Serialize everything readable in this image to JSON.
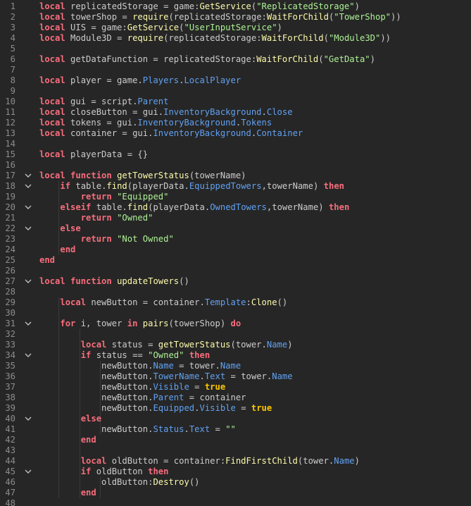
{
  "editor": {
    "language": "Lua",
    "first_line_number": 1,
    "fold_icon": "chevron-down-icon",
    "colors": {
      "background": "#262626",
      "line_number": "#8c8c8c",
      "text": "#cccccc",
      "keyword": "#f86d7c",
      "bool": "#ffc600",
      "method": "#fdfbac",
      "string": "#adf195",
      "property": "#61a1f1",
      "fold_icon": "#bdbdbd"
    },
    "lines": [
      {
        "tokens": [
          [
            "keyword",
            "local"
          ],
          [
            "text",
            " replicatedStorage = game:"
          ],
          [
            "method",
            "GetService"
          ],
          [
            "text",
            "("
          ],
          [
            "string",
            "\"ReplicatedStorage\""
          ],
          [
            "text",
            ")"
          ]
        ]
      },
      {
        "tokens": [
          [
            "keyword",
            "local"
          ],
          [
            "text",
            " towerShop = "
          ],
          [
            "method",
            "require"
          ],
          [
            "text",
            "(replicatedStorage:"
          ],
          [
            "method",
            "WaitForChild"
          ],
          [
            "text",
            "("
          ],
          [
            "string",
            "\"TowerShop\""
          ],
          [
            "text",
            "))"
          ]
        ]
      },
      {
        "tokens": [
          [
            "keyword",
            "local"
          ],
          [
            "text",
            " UIS = game:"
          ],
          [
            "method",
            "GetService"
          ],
          [
            "text",
            "("
          ],
          [
            "string",
            "\"UserInputService\""
          ],
          [
            "text",
            ")"
          ]
        ]
      },
      {
        "tokens": [
          [
            "keyword",
            "local"
          ],
          [
            "text",
            " Module3D = "
          ],
          [
            "method",
            "require"
          ],
          [
            "text",
            "(replicatedStorage:"
          ],
          [
            "method",
            "WaitForChild"
          ],
          [
            "text",
            "("
          ],
          [
            "string",
            "\"Module3D\""
          ],
          [
            "text",
            "))"
          ]
        ]
      },
      {
        "tokens": []
      },
      {
        "tokens": [
          [
            "keyword",
            "local"
          ],
          [
            "text",
            " getDataFunction = replicatedStorage:"
          ],
          [
            "method",
            "WaitForChild"
          ],
          [
            "text",
            "("
          ],
          [
            "string",
            "\"GetData\""
          ],
          [
            "text",
            ")"
          ]
        ]
      },
      {
        "tokens": []
      },
      {
        "tokens": [
          [
            "keyword",
            "local"
          ],
          [
            "text",
            " player = game."
          ],
          [
            "prop",
            "Players"
          ],
          [
            "text",
            "."
          ],
          [
            "prop",
            "LocalPlayer"
          ]
        ]
      },
      {
        "tokens": []
      },
      {
        "tokens": [
          [
            "keyword",
            "local"
          ],
          [
            "text",
            " gui = script."
          ],
          [
            "prop",
            "Parent"
          ]
        ]
      },
      {
        "tokens": [
          [
            "keyword",
            "local"
          ],
          [
            "text",
            " closeButton = gui."
          ],
          [
            "prop",
            "InventoryBackground"
          ],
          [
            "text",
            "."
          ],
          [
            "prop",
            "Close"
          ]
        ]
      },
      {
        "tokens": [
          [
            "keyword",
            "local"
          ],
          [
            "text",
            " tokens = gui."
          ],
          [
            "prop",
            "InventoryBackground"
          ],
          [
            "text",
            "."
          ],
          [
            "prop",
            "Tokens"
          ]
        ]
      },
      {
        "tokens": [
          [
            "keyword",
            "local"
          ],
          [
            "text",
            " container = gui."
          ],
          [
            "prop",
            "InventoryBackground"
          ],
          [
            "text",
            "."
          ],
          [
            "prop",
            "Container"
          ]
        ]
      },
      {
        "tokens": []
      },
      {
        "tokens": [
          [
            "keyword",
            "local"
          ],
          [
            "text",
            " playerData = {}"
          ]
        ]
      },
      {
        "tokens": []
      },
      {
        "fold": true,
        "tokens": [
          [
            "keyword",
            "local"
          ],
          [
            "text",
            " "
          ],
          [
            "keyword",
            "function"
          ],
          [
            "text",
            " "
          ],
          [
            "method",
            "getTowerStatus"
          ],
          [
            "text",
            "(towerName)"
          ]
        ]
      },
      {
        "fold": true,
        "tokens": [
          [
            "text",
            "    "
          ],
          [
            "keyword",
            "if"
          ],
          [
            "text",
            " table."
          ],
          [
            "method",
            "find"
          ],
          [
            "text",
            "(playerData."
          ],
          [
            "prop",
            "EquippedTowers"
          ],
          [
            "text",
            ",towerName) "
          ],
          [
            "keyword",
            "then"
          ]
        ]
      },
      {
        "tokens": [
          [
            "text",
            "        "
          ],
          [
            "keyword",
            "return"
          ],
          [
            "text",
            " "
          ],
          [
            "string",
            "\"Equipped\""
          ]
        ]
      },
      {
        "fold": true,
        "tokens": [
          [
            "text",
            "    "
          ],
          [
            "keyword",
            "elseif"
          ],
          [
            "text",
            " table."
          ],
          [
            "method",
            "find"
          ],
          [
            "text",
            "(playerData."
          ],
          [
            "prop",
            "OwnedTowers"
          ],
          [
            "text",
            ",towerName) "
          ],
          [
            "keyword",
            "then"
          ]
        ]
      },
      {
        "tokens": [
          [
            "text",
            "        "
          ],
          [
            "keyword",
            "return"
          ],
          [
            "text",
            " "
          ],
          [
            "string",
            "\"Owned\""
          ]
        ]
      },
      {
        "fold": true,
        "tokens": [
          [
            "text",
            "    "
          ],
          [
            "keyword",
            "else"
          ]
        ]
      },
      {
        "tokens": [
          [
            "text",
            "        "
          ],
          [
            "keyword",
            "return"
          ],
          [
            "text",
            " "
          ],
          [
            "string",
            "\"Not Owned\""
          ]
        ]
      },
      {
        "tokens": [
          [
            "text",
            "    "
          ],
          [
            "keyword",
            "end"
          ]
        ]
      },
      {
        "tokens": [
          [
            "keyword",
            "end"
          ]
        ]
      },
      {
        "tokens": []
      },
      {
        "fold": true,
        "tokens": [
          [
            "keyword",
            "local"
          ],
          [
            "text",
            " "
          ],
          [
            "keyword",
            "function"
          ],
          [
            "text",
            " "
          ],
          [
            "method",
            "updateTowers"
          ],
          [
            "text",
            "()"
          ]
        ]
      },
      {
        "tokens": []
      },
      {
        "tokens": [
          [
            "text",
            "    "
          ],
          [
            "keyword",
            "local"
          ],
          [
            "text",
            " newButton = container."
          ],
          [
            "prop",
            "Template"
          ],
          [
            "text",
            ":"
          ],
          [
            "method",
            "Clone"
          ],
          [
            "text",
            "()"
          ]
        ]
      },
      {
        "tokens": []
      },
      {
        "fold": true,
        "tokens": [
          [
            "text",
            "    "
          ],
          [
            "keyword",
            "for"
          ],
          [
            "text",
            " i, tower "
          ],
          [
            "keyword",
            "in"
          ],
          [
            "text",
            " "
          ],
          [
            "method",
            "pairs"
          ],
          [
            "text",
            "(towerShop) "
          ],
          [
            "keyword",
            "do"
          ]
        ]
      },
      {
        "tokens": []
      },
      {
        "tokens": [
          [
            "text",
            "        "
          ],
          [
            "keyword",
            "local"
          ],
          [
            "text",
            " status = "
          ],
          [
            "method",
            "getTowerStatus"
          ],
          [
            "text",
            "(tower."
          ],
          [
            "prop",
            "Name"
          ],
          [
            "text",
            ")"
          ]
        ]
      },
      {
        "fold": true,
        "tokens": [
          [
            "text",
            "        "
          ],
          [
            "keyword",
            "if"
          ],
          [
            "text",
            " status == "
          ],
          [
            "string",
            "\"Owned\""
          ],
          [
            "text",
            " "
          ],
          [
            "keyword",
            "then"
          ]
        ]
      },
      {
        "tokens": [
          [
            "text",
            "            newButton."
          ],
          [
            "prop",
            "Name"
          ],
          [
            "text",
            " = tower."
          ],
          [
            "prop",
            "Name"
          ]
        ]
      },
      {
        "tokens": [
          [
            "text",
            "            newButton."
          ],
          [
            "prop",
            "TowerName"
          ],
          [
            "text",
            "."
          ],
          [
            "prop",
            "Text"
          ],
          [
            "text",
            " = tower."
          ],
          [
            "prop",
            "Name"
          ]
        ]
      },
      {
        "tokens": [
          [
            "text",
            "            newButton."
          ],
          [
            "prop",
            "Visible"
          ],
          [
            "text",
            " = "
          ],
          [
            "bool",
            "true"
          ]
        ]
      },
      {
        "tokens": [
          [
            "text",
            "            newButton."
          ],
          [
            "prop",
            "Parent"
          ],
          [
            "text",
            " = container"
          ]
        ]
      },
      {
        "tokens": [
          [
            "text",
            "            newButton."
          ],
          [
            "prop",
            "Equipped"
          ],
          [
            "text",
            "."
          ],
          [
            "prop",
            "Visible"
          ],
          [
            "text",
            " = "
          ],
          [
            "bool",
            "true"
          ]
        ]
      },
      {
        "fold": true,
        "tokens": [
          [
            "text",
            "        "
          ],
          [
            "keyword",
            "else"
          ]
        ]
      },
      {
        "tokens": [
          [
            "text",
            "            newButton."
          ],
          [
            "prop",
            "Status"
          ],
          [
            "text",
            "."
          ],
          [
            "prop",
            "Text"
          ],
          [
            "text",
            " = "
          ],
          [
            "string",
            "\"\""
          ]
        ]
      },
      {
        "tokens": [
          [
            "text",
            "        "
          ],
          [
            "keyword",
            "end"
          ]
        ]
      },
      {
        "tokens": []
      },
      {
        "tokens": [
          [
            "text",
            "        "
          ],
          [
            "keyword",
            "local"
          ],
          [
            "text",
            " oldButton = container:"
          ],
          [
            "method",
            "FindFirstChild"
          ],
          [
            "text",
            "(tower."
          ],
          [
            "prop",
            "Name"
          ],
          [
            "text",
            ")"
          ]
        ]
      },
      {
        "fold": true,
        "tokens": [
          [
            "text",
            "        "
          ],
          [
            "keyword",
            "if"
          ],
          [
            "text",
            " oldButton "
          ],
          [
            "keyword",
            "then"
          ]
        ]
      },
      {
        "tokens": [
          [
            "text",
            "            oldButton:"
          ],
          [
            "method",
            "Destroy"
          ],
          [
            "text",
            "()"
          ]
        ]
      },
      {
        "tokens": [
          [
            "text",
            "        "
          ],
          [
            "keyword",
            "end"
          ]
        ]
      },
      {
        "tokens": []
      }
    ]
  }
}
